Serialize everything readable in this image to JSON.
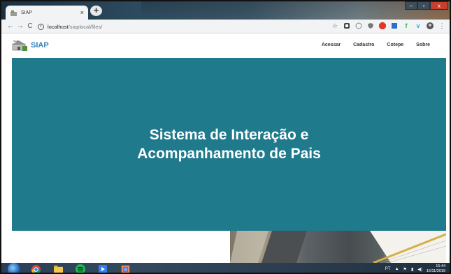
{
  "browser": {
    "tab_title": "SIAP",
    "tab_close": "×",
    "new_tab": "+",
    "window_controls": {
      "minimize": "‒",
      "maximize": "▫",
      "close": "x"
    },
    "nav": {
      "back": "←",
      "forward": "→",
      "reload": "C"
    },
    "url_host": "localhost",
    "url_path": "/siaplocal/files/",
    "icons": [
      "star-icon",
      "pocket-icon",
      "history-icon",
      "shield-icon",
      "adblock-icon",
      "bookmark-icon",
      "feedly-icon",
      "vimeo-icon",
      "avatar-icon",
      "menu-icon"
    ]
  },
  "site": {
    "logo_text": "SIAP",
    "menu": [
      "Acessar",
      "Cadastro",
      "Cotepe",
      "Sobre"
    ],
    "hero_title": "Sistema de Interação e Acompanhamento de Pais",
    "hero_bg": "#1f7a8c"
  },
  "taskbar": {
    "apps": [
      "chrome",
      "explorer",
      "spotify",
      "media",
      "ide"
    ],
    "tray_lang": "PT",
    "time": "15:44",
    "date": "16/11/2019"
  }
}
